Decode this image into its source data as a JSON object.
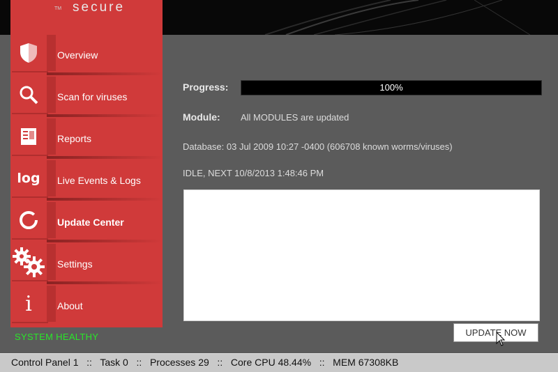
{
  "app": {
    "brand": "secure",
    "trademark": "TM"
  },
  "sidebar": {
    "items": [
      {
        "label": "Overview",
        "icon": "shield-icon",
        "active": false
      },
      {
        "label": "Scan for viruses",
        "icon": "magnifier-icon",
        "active": false
      },
      {
        "label": "Reports",
        "icon": "report-icon",
        "active": false
      },
      {
        "label": "Live Events & Logs",
        "icon": "log-icon",
        "icon_text": "log",
        "active": false
      },
      {
        "label": "Update Center",
        "icon": "refresh-icon",
        "active": true
      },
      {
        "label": "Settings",
        "icon": "gears-icon",
        "active": false
      },
      {
        "label": "About",
        "icon": "info-icon",
        "icon_text": "i",
        "active": false
      }
    ],
    "status": "SYSTEM HEALTHY",
    "status_color": "#29e629"
  },
  "main": {
    "progress_label": "Progress:",
    "progress_value": 100,
    "progress_text": "100%",
    "module_label": "Module:",
    "module_text": "All MODULES are updated",
    "database_text": "Database: 03 Jul 2009 10:27 -0400 (606708 known worms/viruses)",
    "idle_text": "IDLE, NEXT 10/8/2013 1:48:46 PM",
    "update_button": "UPDATE NOW"
  },
  "footer": {
    "text": "Control Panel 1   ::   Task 0   ::   Processes 29   ::   Core CPU 48.44%   ::   MEM 67308KB"
  },
  "colors": {
    "accent_red": "#d03a3a",
    "background": "#5b5b5b",
    "footer_bg": "#c9c9c9"
  }
}
